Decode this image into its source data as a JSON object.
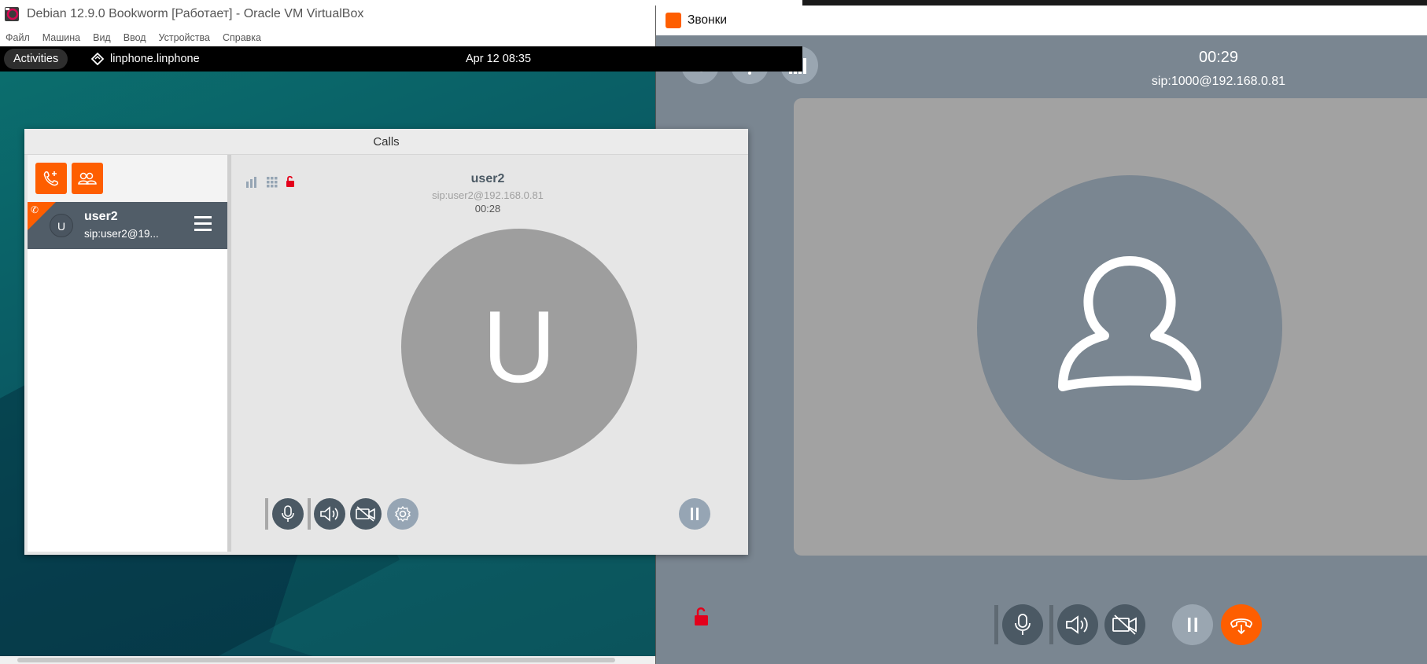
{
  "vbox": {
    "title": "Debian 12.9.0 Bookworm [Работает] - Oracle VM VirtualBox",
    "menu": [
      "Файл",
      "Машина",
      "Вид",
      "Ввод",
      "Устройства",
      "Справка"
    ]
  },
  "gnome": {
    "activities": "Activities",
    "app_name": "linphone.linphone",
    "clock": "Apr 12  08:35"
  },
  "calls_window": {
    "title": "Calls",
    "call_list": [
      {
        "avatar_letter": "U",
        "name": "user2",
        "sip": "sip:user2@19..."
      }
    ],
    "active_call": {
      "name": "user2",
      "sip": "sip:user2@192.168.0.81",
      "duration": "00:28",
      "avatar_letter": "U"
    },
    "colors": {
      "accent": "#fe5e00",
      "sidebar_selected": "#515d68",
      "avatar": "#9e9e9e"
    }
  },
  "zvonki_window": {
    "title": "Звонки",
    "duration": "00:29",
    "sip": "sip:1000@192.168.0.81",
    "colors": {
      "accent": "#fe5e00",
      "background": "#7a8691",
      "stage": "#a2a2a2",
      "unlock": "#e3001b"
    }
  },
  "icons": [
    "virtualbox-logo-icon",
    "linphone-icon",
    "new-call-icon",
    "conference-icon",
    "phone-icon",
    "menu-icon",
    "signal-icon",
    "dialpad-icon",
    "unlock-icon",
    "microphone-icon",
    "speaker-icon",
    "camera-off-icon",
    "settings-icon",
    "pause-icon",
    "call-list-icon",
    "avatar-silhouette-icon",
    "hangup-icon"
  ]
}
